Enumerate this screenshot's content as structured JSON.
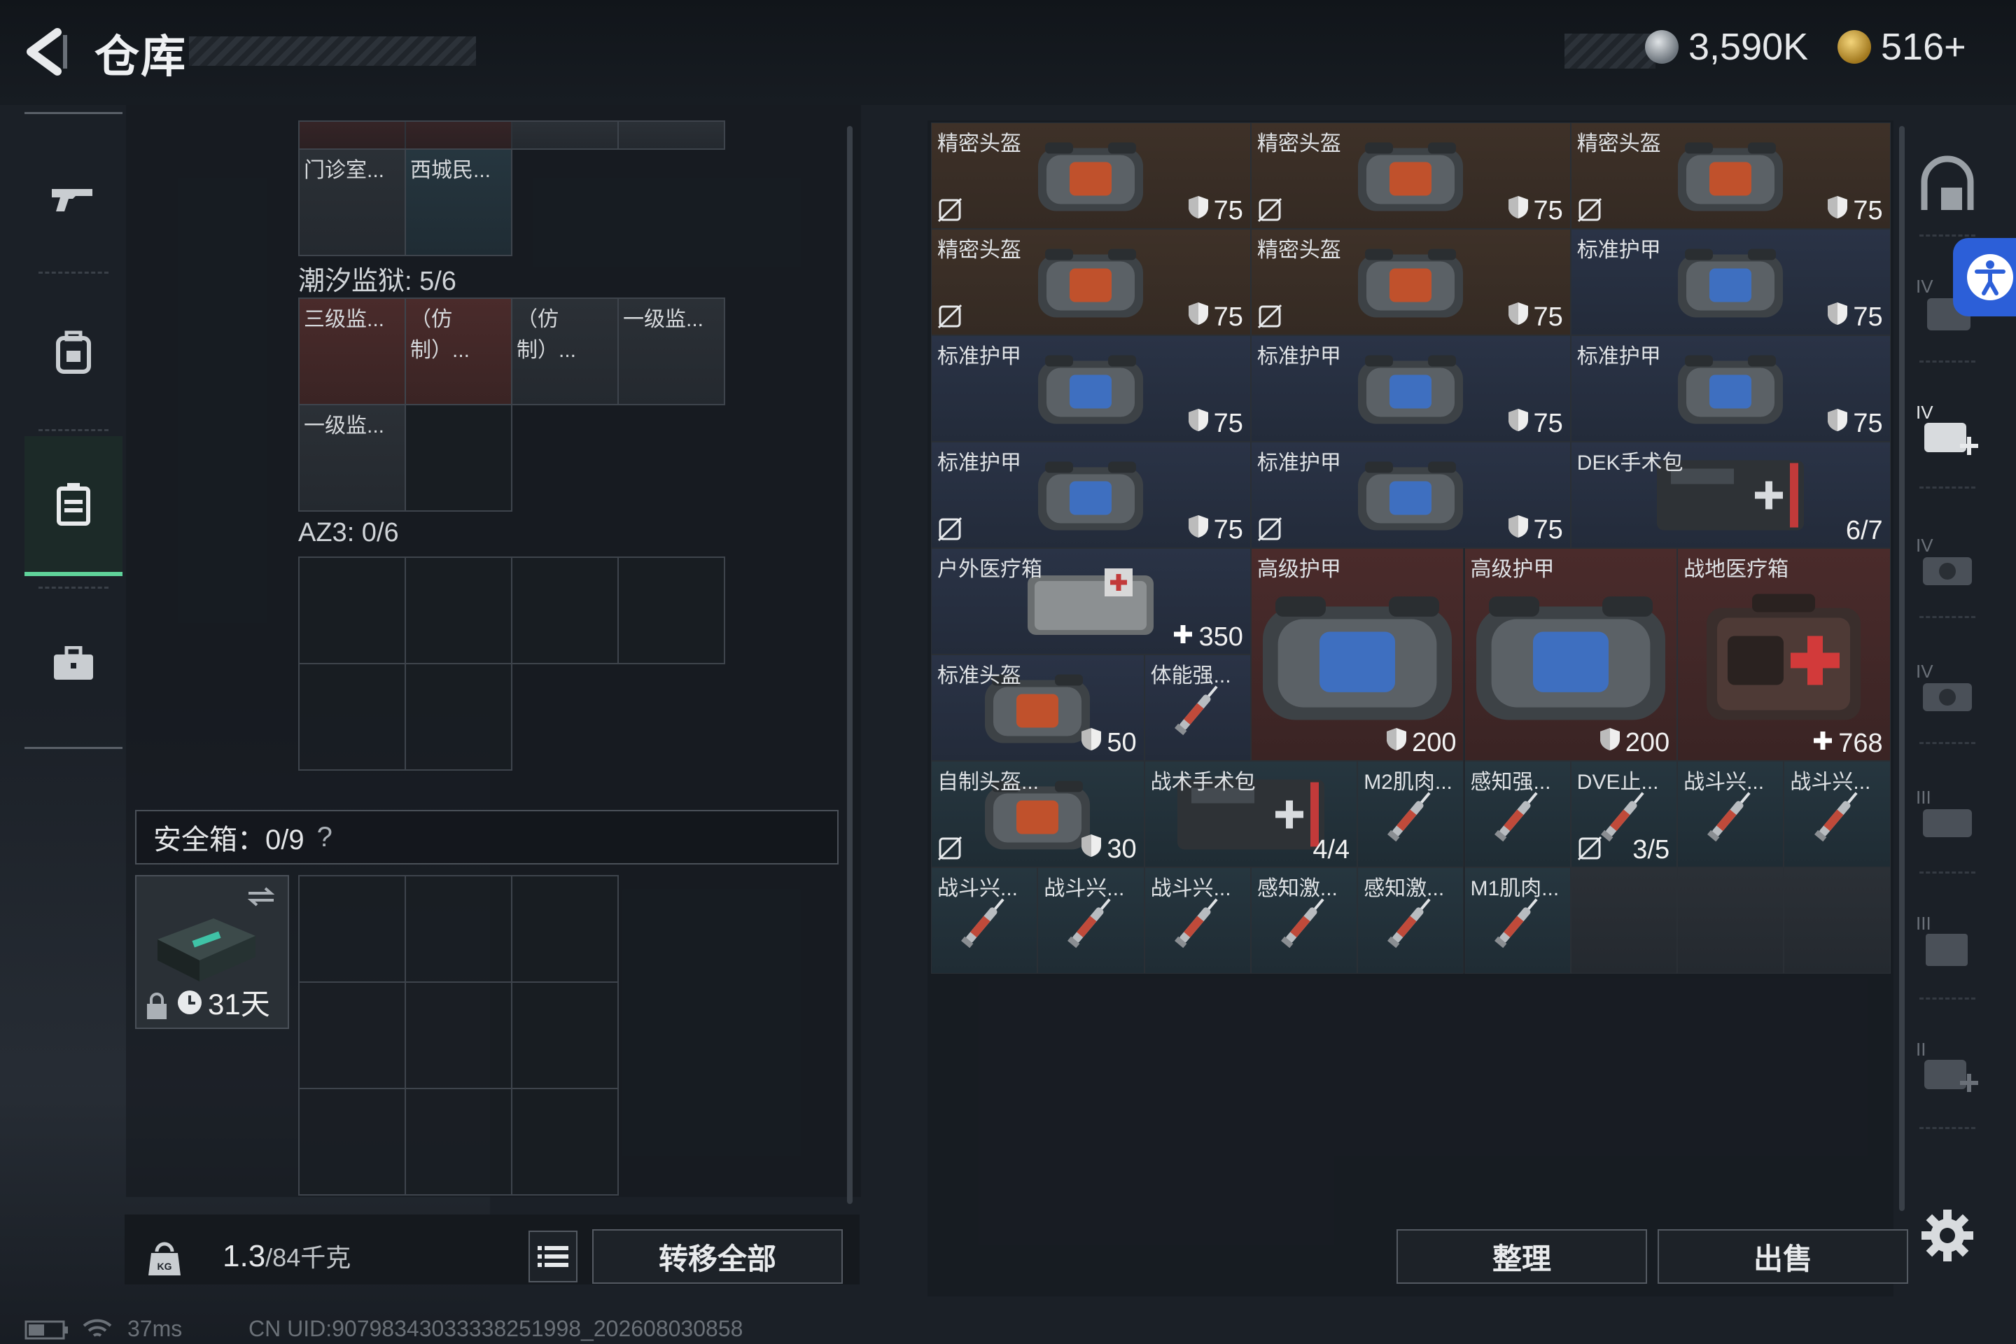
{
  "header": {
    "title": "仓库",
    "currency1": "3,590K",
    "currency2": "516+"
  },
  "container": {
    "top_items": [
      {
        "name": "门诊室...",
        "color": "gray"
      },
      {
        "name": "西城民...",
        "color": "teal"
      }
    ],
    "section1_label": "潮汐监狱: 5/6",
    "section1_items": [
      {
        "name": "三级监...",
        "color": "red"
      },
      {
        "name": "（仿制）...",
        "color": "red"
      },
      {
        "name": "（仿制）...",
        "color": "gray"
      },
      {
        "name": "一级监...",
        "color": "gray"
      },
      {
        "name": "一级监...",
        "color": "gray"
      }
    ],
    "section2_label": "AZ3: 0/6"
  },
  "safe": {
    "label": "安全箱：0/9",
    "help": "?",
    "timer": "31天"
  },
  "bottom": {
    "weight": "1.3",
    "weight_max": "/84千克",
    "transfer_all": "转移全部"
  },
  "stash_items": [
    {
      "name": "精密头盔",
      "value": "75",
      "type": "helmet",
      "color": "brown",
      "x": 0,
      "y": 0,
      "w": 3,
      "h": 1,
      "nosell": true
    },
    {
      "name": "精密头盔",
      "value": "75",
      "type": "helmet",
      "color": "brown",
      "x": 3,
      "y": 0,
      "w": 3,
      "h": 1,
      "nosell": true
    },
    {
      "name": "精密头盔",
      "value": "75",
      "type": "helmet",
      "color": "brown",
      "x": 6,
      "y": 0,
      "w": 3,
      "h": 1,
      "nosell": true
    },
    {
      "name": "精密头盔",
      "value": "75",
      "type": "helmet",
      "color": "brown",
      "x": 0,
      "y": 1,
      "w": 3,
      "h": 1,
      "nosell": true
    },
    {
      "name": "精密头盔",
      "value": "75",
      "type": "helmet",
      "color": "brown",
      "x": 3,
      "y": 1,
      "w": 3,
      "h": 1,
      "nosell": true
    },
    {
      "name": "标准护甲",
      "value": "75",
      "type": "vest",
      "color": "blue",
      "x": 6,
      "y": 1,
      "w": 3,
      "h": 1,
      "nosell": false
    },
    {
      "name": "标准护甲",
      "value": "75",
      "type": "vest",
      "color": "blue",
      "x": 0,
      "y": 2,
      "w": 3,
      "h": 1,
      "nosell": false
    },
    {
      "name": "标准护甲",
      "value": "75",
      "type": "vest",
      "color": "blue",
      "x": 3,
      "y": 2,
      "w": 3,
      "h": 1,
      "nosell": false
    },
    {
      "name": "标准护甲",
      "value": "75",
      "type": "vest",
      "color": "blue",
      "x": 6,
      "y": 2,
      "w": 3,
      "h": 1,
      "nosell": false
    },
    {
      "name": "标准护甲",
      "value": "75",
      "type": "vest",
      "color": "blue",
      "x": 0,
      "y": 3,
      "w": 3,
      "h": 1,
      "nosell": true
    },
    {
      "name": "标准护甲",
      "value": "75",
      "type": "vest",
      "color": "blue",
      "x": 3,
      "y": 3,
      "w": 3,
      "h": 1,
      "nosell": true
    },
    {
      "name": "DEK手术包",
      "value": "6/7",
      "type": "kit",
      "color": "blue",
      "x": 6,
      "y": 3,
      "w": 3,
      "h": 1,
      "nosell": false
    },
    {
      "name": "户外医疗箱",
      "value": "350",
      "type": "med",
      "color": "blue",
      "x": 0,
      "y": 4,
      "w": 3,
      "h": 1,
      "nosell": false,
      "icon": "plus"
    },
    {
      "name": "标准头盔",
      "value": "50",
      "type": "helmet",
      "color": "blue",
      "x": 0,
      "y": 5,
      "w": 2,
      "h": 1,
      "nosell": false
    },
    {
      "name": "体能强...",
      "value": "",
      "type": "syringe",
      "color": "blue",
      "x": 2,
      "y": 5,
      "w": 1,
      "h": 1,
      "nosell": false
    },
    {
      "name": "高级护甲",
      "value": "200",
      "type": "vest",
      "color": "red",
      "x": 3,
      "y": 4,
      "w": 2,
      "h": 2,
      "nosell": false
    },
    {
      "name": "高级护甲",
      "value": "200",
      "type": "vest",
      "color": "red",
      "x": 5,
      "y": 4,
      "w": 2,
      "h": 2,
      "nosell": false
    },
    {
      "name": "战地医疗箱",
      "value": "768",
      "type": "firstaid",
      "color": "red",
      "x": 7,
      "y": 4,
      "w": 2,
      "h": 2,
      "nosell": false,
      "icon": "plus"
    },
    {
      "name": "自制头盔...",
      "value": "30",
      "type": "helmet",
      "color": "teal",
      "x": 0,
      "y": 6,
      "w": 2,
      "h": 1,
      "nosell": true
    },
    {
      "name": "战术手术包",
      "value": "4/4",
      "type": "kit",
      "color": "teal",
      "x": 2,
      "y": 6,
      "w": 2,
      "h": 1,
      "nosell": false
    },
    {
      "name": "M2肌肉...",
      "value": "",
      "type": "syringe",
      "color": "teal",
      "x": 4,
      "y": 6,
      "w": 1,
      "h": 1,
      "nosell": false
    },
    {
      "name": "感知强...",
      "value": "",
      "type": "syringe",
      "color": "teal",
      "x": 5,
      "y": 6,
      "w": 1,
      "h": 1,
      "nosell": false
    },
    {
      "name": "DVE止...",
      "value": "3/5",
      "type": "syringe",
      "color": "teal",
      "x": 6,
      "y": 6,
      "w": 1,
      "h": 1,
      "nosell": true
    },
    {
      "name": "战斗兴...",
      "value": "",
      "type": "syringe",
      "color": "teal",
      "x": 7,
      "y": 6,
      "w": 1,
      "h": 1,
      "nosell": false
    },
    {
      "name": "战斗兴...",
      "value": "",
      "type": "syringe",
      "color": "teal",
      "x": 8,
      "y": 6,
      "w": 1,
      "h": 1,
      "nosell": false
    },
    {
      "name": "战斗兴...",
      "value": "",
      "type": "syringe",
      "color": "teal",
      "x": 0,
      "y": 7,
      "w": 1,
      "h": 1,
      "nosell": false
    },
    {
      "name": "战斗兴...",
      "value": "",
      "type": "syringe",
      "color": "teal",
      "x": 1,
      "y": 7,
      "w": 1,
      "h": 1,
      "nosell": false
    },
    {
      "name": "战斗兴...",
      "value": "",
      "type": "syringe",
      "color": "teal",
      "x": 2,
      "y": 7,
      "w": 1,
      "h": 1,
      "nosell": false
    },
    {
      "name": "感知激...",
      "value": "",
      "type": "syringe",
      "color": "teal",
      "x": 3,
      "y": 7,
      "w": 1,
      "h": 1,
      "nosell": false
    },
    {
      "name": "感知激...",
      "value": "",
      "type": "syringe",
      "color": "teal",
      "x": 4,
      "y": 7,
      "w": 1,
      "h": 1,
      "nosell": false
    },
    {
      "name": "M1肌肉...",
      "value": "",
      "type": "syringe",
      "color": "teal",
      "x": 5,
      "y": 7,
      "w": 1,
      "h": 1,
      "nosell": false
    }
  ],
  "stash_actions": {
    "sort": "整理",
    "sell": "出售"
  },
  "status": {
    "ping": "37ms",
    "uid": "CN UID:907983430333382519​98_202608030858"
  }
}
